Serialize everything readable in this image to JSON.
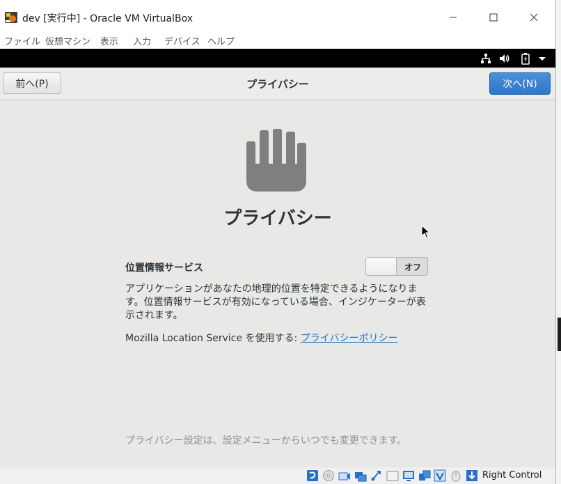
{
  "window": {
    "title": "dev [実行中] - Oracle VM VirtualBox",
    "menu": [
      "ファイル",
      "仮想マシン",
      "表示",
      "入力",
      "デバイス",
      "ヘルプ"
    ]
  },
  "header": {
    "prev_label": "前へ(P)",
    "title": "プライバシー",
    "next_label": "次へ(N)"
  },
  "main": {
    "heading": "プライバシー",
    "location_label": "位置情報サービス",
    "toggle_state": "オフ",
    "description": "アプリケーションがあなたの地理的位置を特定できるようになります。位置情報サービスが有効になっている場合、インジケーターが表示されます。",
    "mls_prefix": "Mozilla Location Service を使用する: ",
    "mls_link": "プライバシーポリシー",
    "footer_note": "プライバシー設定は、設定メニューからいつでも変更できます。"
  },
  "statusbar": {
    "host_key": "Right Control"
  },
  "icons": {
    "app": "virtualbox-icon",
    "topbar": [
      "network-icon",
      "volume-icon",
      "battery-icon",
      "dropdown-icon"
    ],
    "hero": "hand-icon"
  },
  "colors": {
    "accent": "#2f77c9",
    "link": "#2a76c6",
    "background": "#e8e8e7"
  }
}
